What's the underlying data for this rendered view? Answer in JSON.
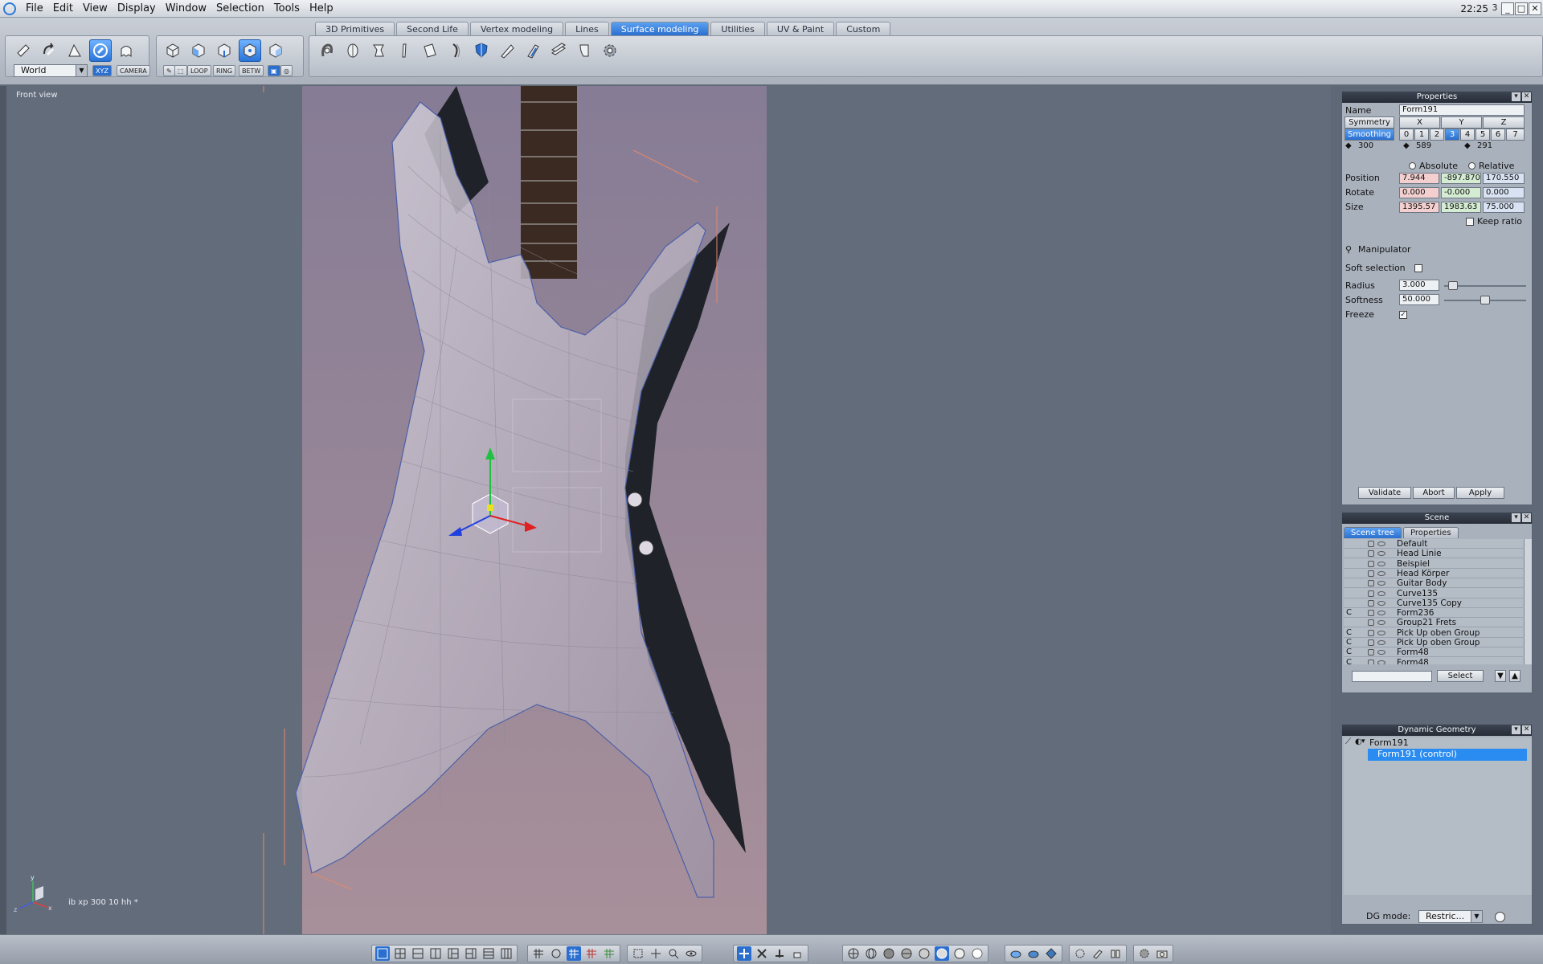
{
  "menubar": {
    "items": [
      "File",
      "Edit",
      "View",
      "Display",
      "Window",
      "Selection",
      "Tools",
      "Help"
    ],
    "clock": "22:25",
    "extra": "3"
  },
  "tabs": [
    "3D Primitives",
    "Second Life",
    "Vertex modeling",
    "Lines",
    "Surface modeling",
    "Utilities",
    "UV & Paint",
    "Custom"
  ],
  "active_tab": "Surface modeling",
  "toolbar": {
    "space_dropdown": "World",
    "xyz_label": "XYZ",
    "camera_label": "CAMERA",
    "loop_label": "LOOP",
    "ring_label": "RING",
    "betw_label": "BETW"
  },
  "viewport": {
    "label": "Front view",
    "info": "ib xp 300 10 hh *",
    "axis_x": "x",
    "axis_y": "y",
    "axis_z": "z"
  },
  "properties": {
    "title": "Properties",
    "name_label": "Name",
    "name_value": "Form191",
    "symmetry_label": "Symmetry",
    "sym_x": "X",
    "sym_y": "Y",
    "sym_z": "Z",
    "smoothing_label": "Smoothing",
    "smoothing_levels": [
      "0",
      "1",
      "2",
      "3",
      "4",
      "5",
      "6",
      "7"
    ],
    "smoothing_active": "3",
    "counts": [
      "300",
      "589",
      "291"
    ],
    "absolute_label": "Absolute",
    "relative_label": "Relative",
    "position_label": "Position",
    "position": [
      "7.944",
      "-897.870",
      "170.550"
    ],
    "rotate_label": "Rotate",
    "rotate": [
      "0.000",
      "-0.000",
      "0.000"
    ],
    "size_label": "Size",
    "size": [
      "1395.57",
      "1983.63",
      "75.000"
    ],
    "keep_ratio_label": "Keep ratio",
    "manipulator_label": "Manipulator",
    "soft_selection_label": "Soft selection",
    "radius_label": "Radius",
    "radius_value": "3.000",
    "radius_fraction": 0.05,
    "softness_label": "Softness",
    "softness_value": "50.000",
    "softness_fraction": 0.5,
    "freeze_label": "Freeze",
    "freeze_checked": "✓",
    "validate_label": "Validate",
    "abort_label": "Abort",
    "apply_label": "Apply"
  },
  "scene": {
    "title": "Scene",
    "tab_tree": "Scene tree",
    "tab_props": "Properties",
    "rows": [
      {
        "c": "",
        "name": "Default"
      },
      {
        "c": "",
        "name": "Head Linie"
      },
      {
        "c": "",
        "name": "Beispiel"
      },
      {
        "c": "",
        "name": "Head Körper"
      },
      {
        "c": "",
        "name": "Guitar Body"
      },
      {
        "c": "",
        "name": "Curve135"
      },
      {
        "c": "",
        "name": "Curve135 Copy"
      },
      {
        "c": "C",
        "name": "Form236"
      },
      {
        "c": "",
        "name": "Group21 Frets"
      },
      {
        "c": "C",
        "name": "Pick Up oben Group"
      },
      {
        "c": "C",
        "name": "Pick Up oben Group"
      },
      {
        "c": "C",
        "name": "Form48"
      },
      {
        "c": "C",
        "name": "Form48"
      }
    ],
    "select_label": "Select"
  },
  "dynamic_geometry": {
    "title": "Dynamic Geometry",
    "items": [
      "Form191",
      "Form191 (control)"
    ],
    "dg_mode_label": "DG mode:",
    "dg_mode_value": "Restric..."
  },
  "colors": {
    "accent": "#2a6fcf",
    "viewport_bg": "#636c7b",
    "panel_bg": "#a9b1bc"
  }
}
